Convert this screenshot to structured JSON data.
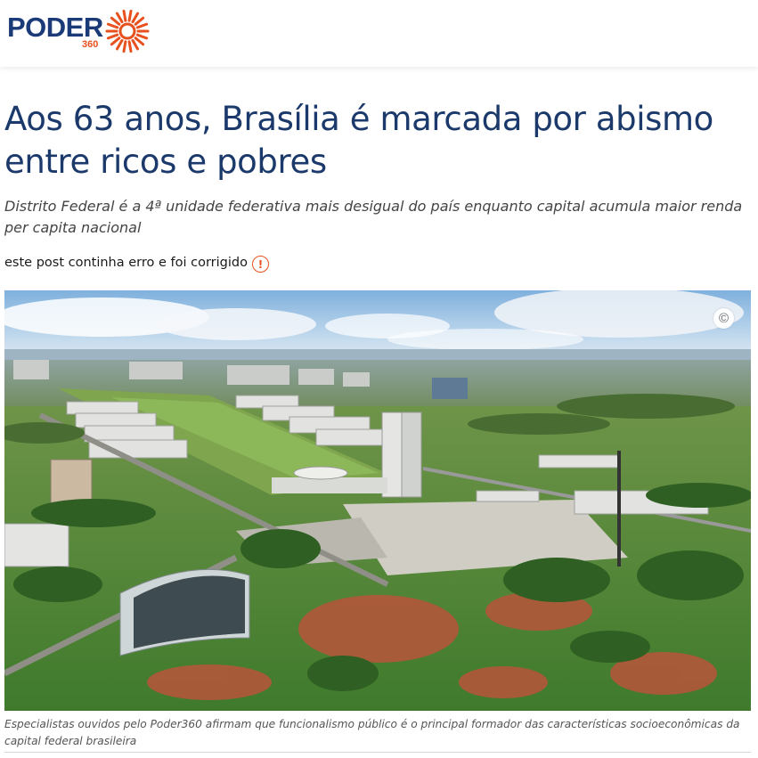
{
  "header": {
    "logo": {
      "word": "PODER",
      "number": "360",
      "icon": "sun-burst-icon"
    }
  },
  "article": {
    "headline": "Aos 63 anos, Brasília é marcada por abismo entre ricos e pobres",
    "subheadline": "Distrito Federal é a 4ª unidade federativa mais desigual do país enquanto capital acumula maior renda per capita nacional",
    "correction_notice": "este post continha erro e foi corrigido",
    "correction_icon": "alert-circle-icon",
    "photo": {
      "description_icon": "copyright-icon",
      "copyright_symbol": "©",
      "caption": "Especialistas ouvidos pelo Poder360 afirmam que funcionalismo público é o principal formador das características socioeconômicas da capital federal brasileira"
    }
  },
  "colors": {
    "brand_blue": "#1b3a78",
    "brand_orange": "#e8501d",
    "headline": "#1b3a6b"
  }
}
